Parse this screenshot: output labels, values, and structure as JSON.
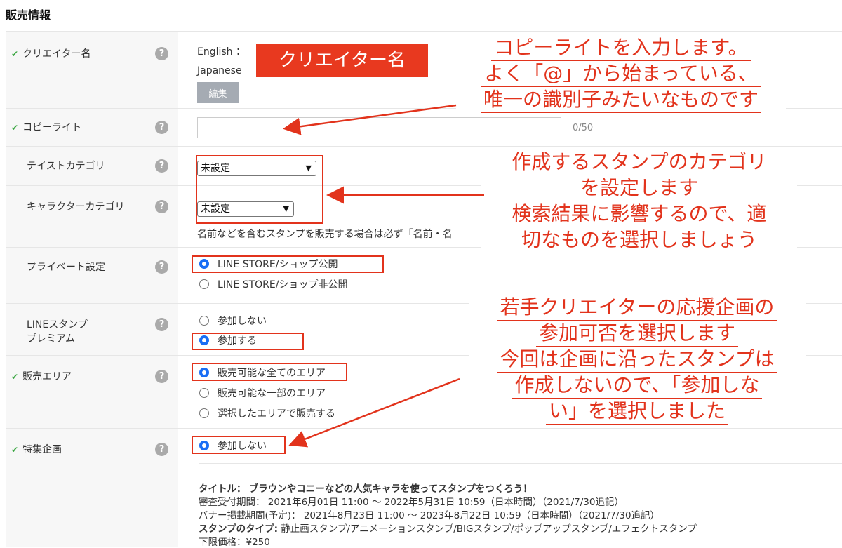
{
  "page_title": "販売情報",
  "help_glyph": "?",
  "check_glyph": "✔",
  "rows": {
    "creator": {
      "label": "クリエイター名",
      "english": "English ：",
      "japanese": "Japanese",
      "edit_button": "編集"
    },
    "copyright": {
      "label": "コピーライト",
      "value": "",
      "counter": "0/50"
    },
    "taste": {
      "label": "テイストカテゴリ",
      "selected": "未設定"
    },
    "character": {
      "label": "キャラクターカテゴリ",
      "selected": "未設定",
      "note": "名前などを含むスタンプを販売する場合は必ず「名前・名"
    },
    "private": {
      "label": "プライベート設定",
      "options": [
        "LINE STORE/ショップ公開",
        "LINE STORE/ショップ非公開"
      ],
      "selected_index": 0
    },
    "premium": {
      "label_line1": "LINEスタンプ",
      "label_line2": "プレミアム",
      "options": [
        "参加しない",
        "参加する"
      ],
      "selected_index": 1
    },
    "area": {
      "label": "販売エリア",
      "options": [
        "販売可能な全てのエリア",
        "販売可能な一部のエリア",
        "選択したエリアで販売する"
      ],
      "selected_index": 0
    },
    "feature": {
      "label": "特集企画",
      "option": "参加しない"
    }
  },
  "feature_details": {
    "title_label": "タイトル：",
    "title_value": "ブラウンやコニーなどの人気キャラを使ってスタンプをつくろう！",
    "review_label": "審査受付期間：",
    "review_value": "2021年6月01日 11:00 〜 2022年5月31日 10:59（日本時間）（2021/7/30追記）",
    "banner_label": "バナー掲載期間(予定)：",
    "banner_value": "2021年8月23日 11:00 〜 2023年8月22日 10:59（日本時間）（2021/7/30追記）",
    "type_label": "スタンプのタイプ:",
    "type_value": "静止画スタンプ/アニメーションスタンプ/BIGスタンプ/ポップアップスタンプ/エフェクトスタンプ",
    "price_partial": "下限価格：¥250"
  },
  "annotations": {
    "creator_tag": "クリエイター名",
    "copyright_note": [
      "コピーライトを入力します。",
      "よく「@」から始まっている、",
      "唯一の識別子みたいなものです"
    ],
    "category_note": [
      "作成するスタンプのカテゴリ",
      "を設定します",
      "検索結果に影響するので、適",
      "切なものを選択しましょう"
    ],
    "premium_note": [
      "若手クリエイターの応援企画の",
      "参加可否を選択します",
      "今回は企画に沿ったスタンプは",
      "作成しないので、「参加しな",
      "い」を選択しました"
    ]
  },
  "colors": {
    "annotation_red": "#e2331c",
    "radio_blue": "#1a6ef5",
    "check_green": "#3aa642"
  }
}
